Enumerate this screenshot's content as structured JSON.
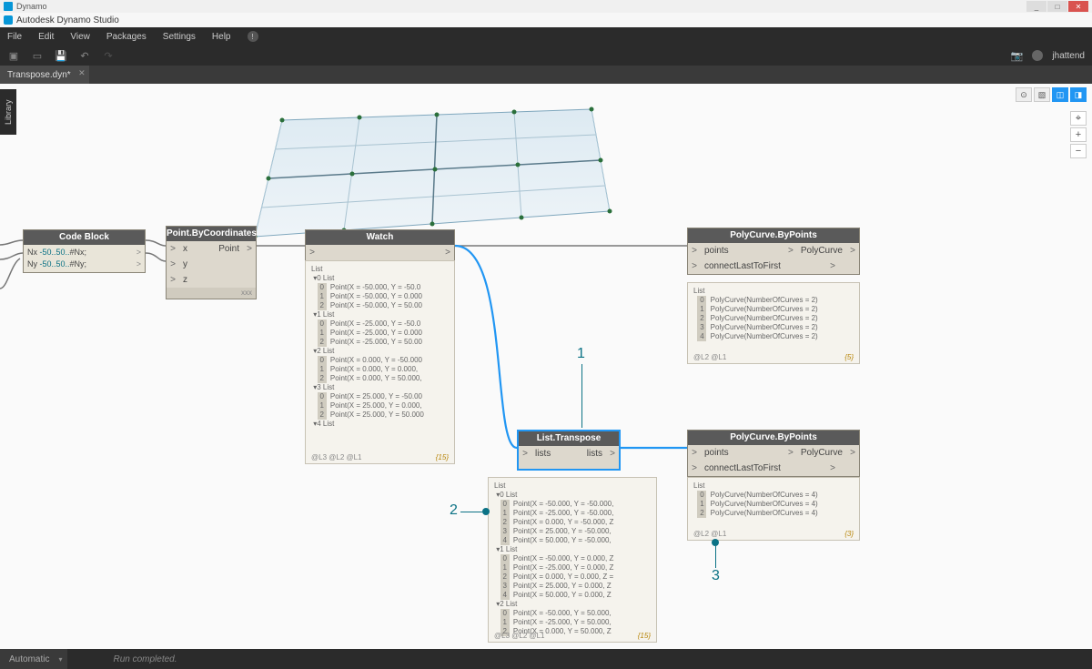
{
  "window": {
    "app_name": "Dynamo",
    "product_line": "Autodesk Dynamo Studio"
  },
  "menu": {
    "items": [
      "File",
      "Edit",
      "View",
      "Packages",
      "Settings",
      "Help"
    ]
  },
  "toolbar": {
    "username": "jhattend"
  },
  "tabs": {
    "active": "Transpose.dyn*"
  },
  "library_label": "Library",
  "runmode": "Automatic",
  "runmsg": "Run completed.",
  "nodes": {
    "codeblock": {
      "title": "Code Block",
      "line1_pre": "Nx ",
      "line1_range": "-50..50..",
      "line1_post": "#Nx;",
      "line2_pre": "Ny ",
      "line2_range": "-50..50..",
      "line2_post": "#Ny;"
    },
    "pbc": {
      "title": "Point.ByCoordinates",
      "in_x": "x",
      "in_y": "y",
      "in_z": "z",
      "out": "Point",
      "lacing": "xxx"
    },
    "watch": {
      "title": "Watch",
      "footer_left": "@L3 @L2 @L1",
      "footer_count": "{15}",
      "content": [
        "List",
        " ▾0 List",
        "   [0] Point(X = -50.000, Y = -50.0",
        "   [1] Point(X = -50.000, Y = 0.000",
        "   [2] Point(X = -50.000, Y = 50.00",
        " ▾1 List",
        "   [0] Point(X = -25.000, Y = -50.0",
        "   [1] Point(X = -25.000, Y = 0.000",
        "   [2] Point(X = -25.000, Y = 50.00",
        " ▾2 List",
        "   [0] Point(X = 0.000, Y = -50.000",
        "   [1] Point(X = 0.000, Y = 0.000,",
        "   [2] Point(X = 0.000, Y = 50.000,",
        " ▾3 List",
        "   [0] Point(X = 25.000, Y = -50.00",
        "   [1] Point(X = 25.000, Y = 0.000,",
        "   [2] Point(X = 25.000, Y = 50.000",
        " ▾4 List"
      ]
    },
    "transpose": {
      "title": "List.Transpose",
      "in": "lists",
      "out": "lists"
    },
    "pcbp1": {
      "title": "PolyCurve.ByPoints",
      "in1": "points",
      "in2": "connectLastToFirst",
      "out": "PolyCurve",
      "listfooter_left": "@L2 @L1",
      "listfooter_count": "{5}",
      "content": [
        "List",
        "  [0] PolyCurve(NumberOfCurves = 2)",
        "  [1] PolyCurve(NumberOfCurves = 2)",
        "  [2] PolyCurve(NumberOfCurves = 2)",
        "  [3] PolyCurve(NumberOfCurves = 2)",
        "  [4] PolyCurve(NumberOfCurves = 2)"
      ]
    },
    "pcbp2": {
      "title": "PolyCurve.ByPoints",
      "in1": "points",
      "in2": "connectLastToFirst",
      "out": "PolyCurve",
      "listfooter_left": "@L2 @L1",
      "listfooter_count": "{3}",
      "content": [
        "List",
        "  [0] PolyCurve(NumberOfCurves = 4)",
        "  [1] PolyCurve(NumberOfCurves = 4)",
        "  [2] PolyCurve(NumberOfCurves = 4)"
      ]
    },
    "transpose_out": {
      "footer_left": "@L3 @L2 @L1",
      "footer_count": "{15}",
      "content": [
        "List",
        " ▾0 List",
        "   [0] Point(X = -50.000, Y = -50.000,",
        "   [1] Point(X = -25.000, Y = -50.000,",
        "   [2] Point(X = 0.000, Y = -50.000, Z",
        "   [3] Point(X = 25.000, Y = -50.000,",
        "   [4] Point(X = 50.000, Y = -50.000,",
        " ▾1 List",
        "   [0] Point(X = -50.000, Y = 0.000, Z",
        "   [1] Point(X = -25.000, Y = 0.000, Z",
        "   [2] Point(X = 0.000, Y = 0.000, Z =",
        "   [3] Point(X = 25.000, Y = 0.000, Z",
        "   [4] Point(X = 50.000, Y = 0.000, Z",
        " ▾2 List",
        "   [0] Point(X = -50.000, Y = 50.000,",
        "   [1] Point(X = -25.000, Y = 50.000,",
        "   [2] Point(X = 0.000, Y = 50.000, Z"
      ]
    }
  },
  "annotations": {
    "a1": "1",
    "a2": "2",
    "a3": "3"
  }
}
